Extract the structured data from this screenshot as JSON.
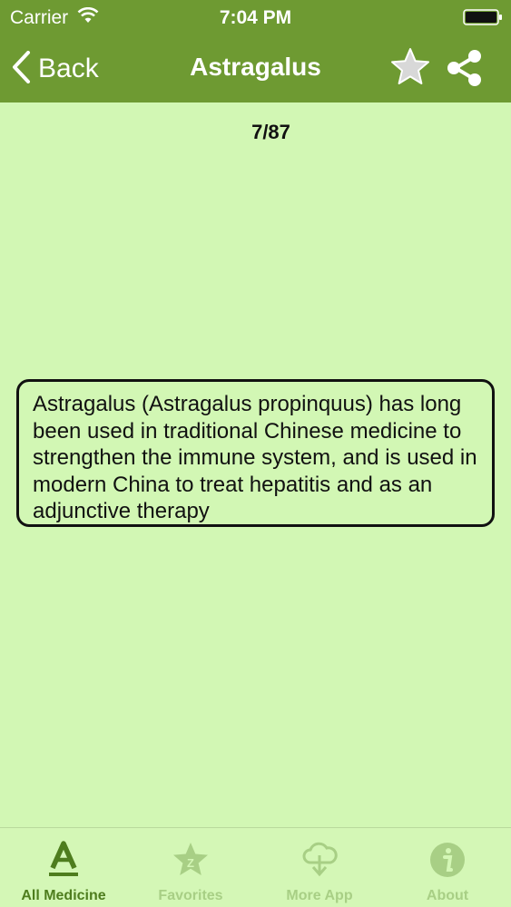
{
  "status_bar": {
    "carrier": "Carrier",
    "time": "7:04 PM",
    "wifi_icon": "wifi-icon",
    "battery_icon": "battery-icon"
  },
  "nav": {
    "back_label": "Back",
    "title": "Astragalus",
    "favorite_icon": "star-icon",
    "share_icon": "share-icon"
  },
  "content": {
    "counter": "7/87",
    "description": "Astragalus (Astragalus propinquus) has long been used in traditional Chinese medicine to strengthen the immune system, and is used in modern China to treat hepatitis and as an adjunctive therapy"
  },
  "tabs": [
    {
      "label": "All Medicine",
      "icon": "letter-a-icon",
      "active": true
    },
    {
      "label": "Favorites",
      "icon": "favorites-star-icon",
      "active": false
    },
    {
      "label": "More App",
      "icon": "cloud-download-icon",
      "active": false
    },
    {
      "label": "About",
      "icon": "info-icon",
      "active": false
    }
  ],
  "colors": {
    "header_bg": "#6e9a32",
    "page_bg": "#d2f7b4",
    "tab_active": "#4e7d1e",
    "tab_inactive": "#a8cf85"
  }
}
